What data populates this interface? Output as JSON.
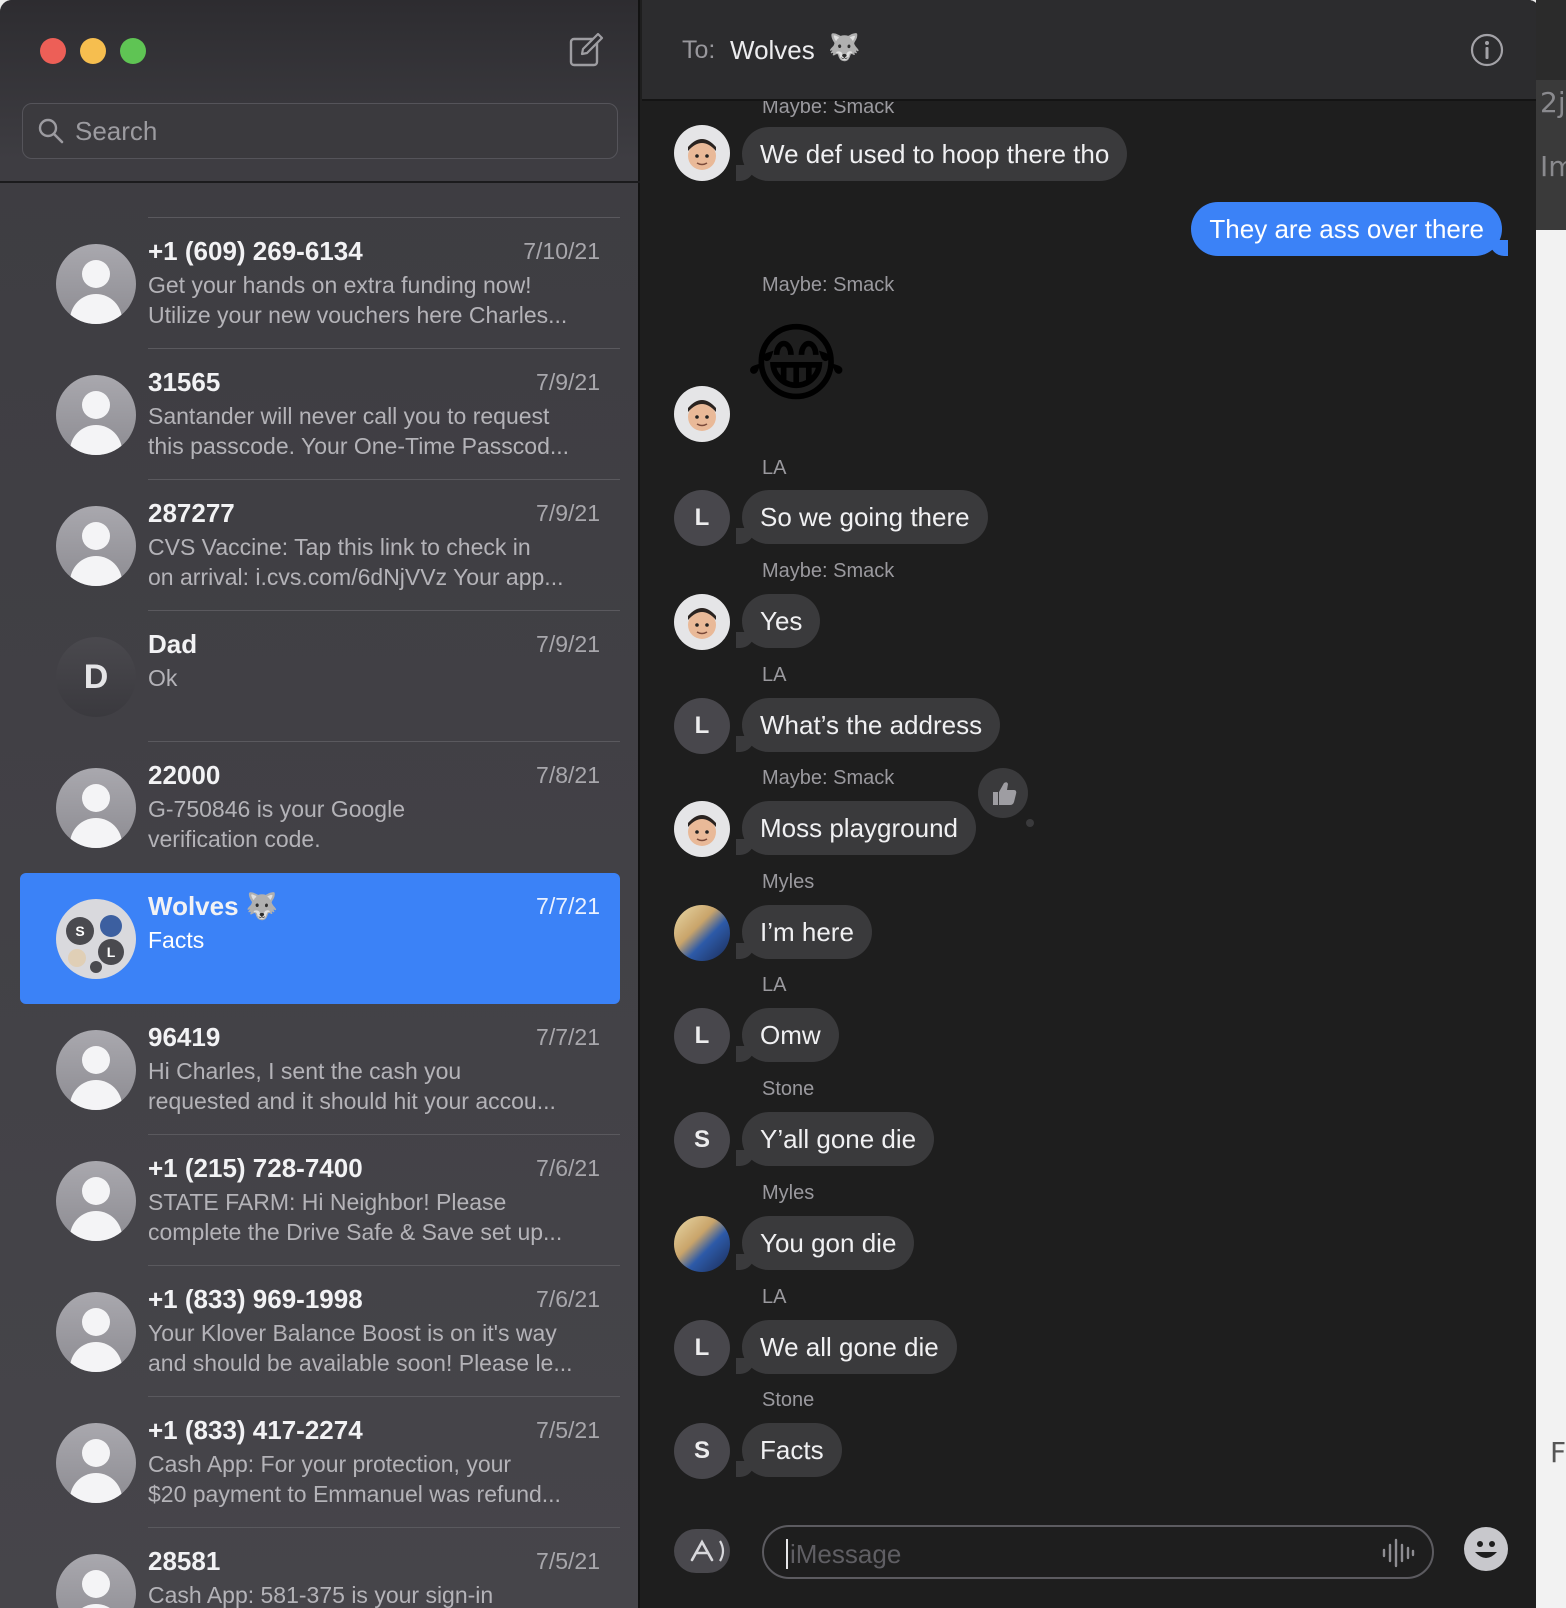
{
  "sidebar": {
    "search_placeholder": "Search",
    "conversations": [
      {
        "name": "+1 (609) 269-6134",
        "date": "7/10/21",
        "line1": "Get your hands on extra funding now!",
        "line2": "Utilize your new vouchers here Charles..."
      },
      {
        "name": "31565",
        "date": "7/9/21",
        "line1": "Santander will never call you to request",
        "line2": "this passcode. Your One-Time Passcod..."
      },
      {
        "name": "287277",
        "date": "7/9/21",
        "line1": "CVS Vaccine: Tap this link to check in",
        "line2": "on arrival: i.cvs.com/6dNjVVz Your app..."
      },
      {
        "name": "Dad",
        "date": "7/9/21",
        "line1": "Ok",
        "line2": "",
        "avatar_letter": "D"
      },
      {
        "name": "22000",
        "date": "7/8/21",
        "line1": "G-750846 is your Google",
        "line2": "verification code."
      },
      {
        "name": "Wolves 🐺",
        "date": "7/7/21",
        "line1": "Facts",
        "line2": "",
        "selected": true
      },
      {
        "name": "96419",
        "date": "7/7/21",
        "line1": "Hi Charles, I sent the cash you",
        "line2": "requested and it should hit your accou..."
      },
      {
        "name": "+1 (215) 728-7400",
        "date": "7/6/21",
        "line1": "STATE FARM: Hi Neighbor! Please",
        "line2": "complete the Drive Safe & Save set up..."
      },
      {
        "name": "+1 (833) 969-1998",
        "date": "7/6/21",
        "line1": "Your Klover Balance Boost is on it's way",
        "line2": "and should be available soon! Please le..."
      },
      {
        "name": "+1 (833) 417-2274",
        "date": "7/5/21",
        "line1": "Cash App: For your protection, your",
        "line2": "$20 payment to Emmanuel was refund..."
      },
      {
        "name": "28581",
        "date": "7/5/21",
        "line1": "Cash App: 581-375 is your sign-in",
        "line2": ""
      }
    ],
    "group_avatar_letters": {
      "s": "S",
      "l": "L"
    }
  },
  "chat": {
    "to_label": "To:",
    "to_name": "Wolves",
    "to_emoji": "🐺",
    "messages": [
      {
        "sender": "Maybe: Smack",
        "text": "We def used to hoop there tho"
      },
      {
        "sender": "",
        "text": "They are ass over there",
        "me": true
      },
      {
        "sender": "Maybe: Smack",
        "text": "😂",
        "emoji": true
      },
      {
        "sender": "LA",
        "text": "So we going there",
        "avatar": "L"
      },
      {
        "sender": "Maybe: Smack",
        "text": "Yes"
      },
      {
        "sender": "LA",
        "text": "What’s the address",
        "avatar": "L"
      },
      {
        "sender": "Maybe: Smack",
        "text": "Moss playground",
        "tapback": "thumbs-up"
      },
      {
        "sender": "Myles",
        "text": "I’m here"
      },
      {
        "sender": "LA",
        "text": "Omw",
        "avatar": "L"
      },
      {
        "sender": "Stone",
        "text": "Y’all gone die",
        "avatar": "S"
      },
      {
        "sender": "Myles",
        "text": "You gon die"
      },
      {
        "sender": "LA",
        "text": "We all gone die",
        "avatar": "L"
      },
      {
        "sender": "Stone",
        "text": "Facts",
        "avatar": "S"
      }
    ],
    "input_placeholder": "iMessage"
  },
  "background_app": {
    "text1": "2j",
    "text2": "Im",
    "text3": "F"
  },
  "colors": {
    "accent": "#3b82f7",
    "bubble_gray": "#3a3a3c",
    "window_bg": "#1e1e1e"
  }
}
